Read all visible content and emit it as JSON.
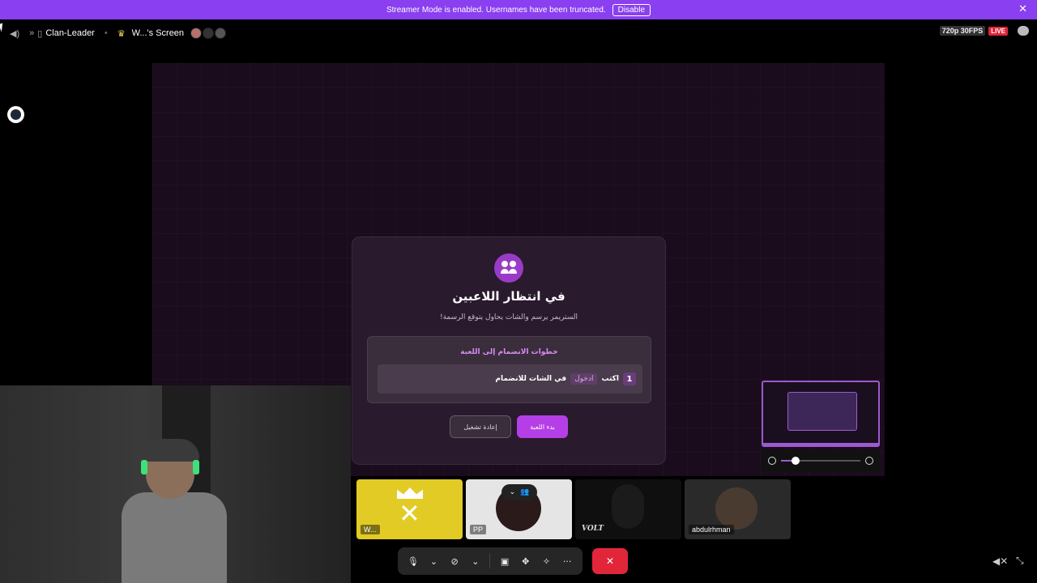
{
  "banner": {
    "text": "Streamer Mode is enabled. Usernames have been truncated.",
    "disable_label": "Disable",
    "close_icon": "close-icon"
  },
  "header": {
    "channel_name": "Clan-Leader",
    "screen_name": "W...'s Screen",
    "quality": "720p 30FPS",
    "live": "LIVE"
  },
  "dialog": {
    "title": "في انتظار اللاعبين",
    "subtitle": "الستريمر يرسم والشات يحاول يتوقع الرسمة!",
    "steps_title": "خطوات الانضمام إلى اللعبة",
    "step_number": "1",
    "step_prefix": "اكتب",
    "step_keyword": "ادخول",
    "step_suffix": "في الشات للانضمام",
    "restart_label": "إعادة تشغيل",
    "start_label": "بدء اللعبة"
  },
  "participants": [
    {
      "label": "W..."
    },
    {
      "label": "PP"
    },
    {
      "label": "VOLT"
    },
    {
      "label": "abdulrhman"
    }
  ],
  "zoom": {
    "level_fraction": 0.18
  },
  "colors": {
    "banner": "#8a3ff0",
    "accent": "#b53fe6",
    "live": "#e0243a",
    "hangup": "#e2263a"
  }
}
